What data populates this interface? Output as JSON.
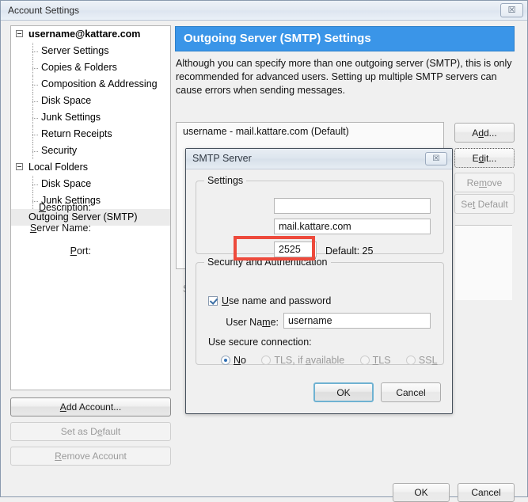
{
  "window": {
    "title": "Account Settings",
    "close_label": "☒"
  },
  "sidebar": {
    "items": [
      {
        "label": "username@kattare.com",
        "level": 0,
        "type": "root",
        "expanded": true,
        "selected": false
      },
      {
        "label": "Server Settings",
        "level": 1,
        "type": "child",
        "selected": false
      },
      {
        "label": "Copies & Folders",
        "level": 1,
        "type": "child",
        "selected": false
      },
      {
        "label": "Composition & Addressing",
        "level": 1,
        "type": "child",
        "selected": false
      },
      {
        "label": "Disk Space",
        "level": 1,
        "type": "child",
        "selected": false
      },
      {
        "label": "Junk Settings",
        "level": 1,
        "type": "child",
        "selected": false
      },
      {
        "label": "Return Receipts",
        "level": 1,
        "type": "child",
        "selected": false
      },
      {
        "label": "Security",
        "level": 1,
        "type": "child",
        "selected": false
      },
      {
        "label": "Local Folders",
        "level": 0,
        "type": "root-plain",
        "expanded": true,
        "selected": false
      },
      {
        "label": "Disk Space",
        "level": 1,
        "type": "child",
        "selected": false
      },
      {
        "label": "Junk Settings",
        "level": 1,
        "type": "child",
        "selected": false
      },
      {
        "label": "Outgoing Server (SMTP)",
        "level": 0,
        "type": "plain",
        "selected": true
      }
    ],
    "add_account": "Add Account...",
    "set_as_default": "Set as Default",
    "remove_account": "Remove Account"
  },
  "panel": {
    "header": "Outgoing Server (SMTP) Settings",
    "description": "Although you can specify more than one outgoing server (SMTP), this is only recommended for advanced users. Setting up multiple SMTP servers can cause errors when sending messages.",
    "servers": [
      "username - mail.kattare.com (Default)"
    ],
    "buttons": {
      "add": "Add...",
      "edit": "Edit...",
      "remove": "Remove",
      "set_default": "Set Default"
    },
    "ghost_text": "S"
  },
  "dialog": {
    "title": "SMTP Server",
    "close_label": "☒",
    "settings_group": "Settings",
    "description_label": "Description:",
    "description_value": "",
    "description_placeholder": "",
    "server_name_label": "Server Name:",
    "server_name_value": "mail.kattare.com",
    "port_label": "Port:",
    "port_value": "2525",
    "default_port_label": "Default:   25",
    "security_group": "Security and Authentication",
    "use_name_password_label": "Use name and password",
    "use_name_password_checked": true,
    "user_name_label": "User Name:",
    "user_name_value": "username",
    "secure_connection_label": "Use secure connection:",
    "secure_options": [
      {
        "label": "No",
        "selected": true,
        "disabled": false
      },
      {
        "label": "TLS, if available",
        "selected": false,
        "disabled": true
      },
      {
        "label": "TLS",
        "selected": false,
        "disabled": true
      },
      {
        "label": "SSL",
        "selected": false,
        "disabled": true
      }
    ],
    "ok": "OK",
    "cancel": "Cancel"
  },
  "footer": {
    "ok": "OK",
    "cancel": "Cancel"
  },
  "colors": {
    "accent": "#3a95e8",
    "highlight_box": "#ed4a3c",
    "default_button_border": "#6fb2d2"
  }
}
